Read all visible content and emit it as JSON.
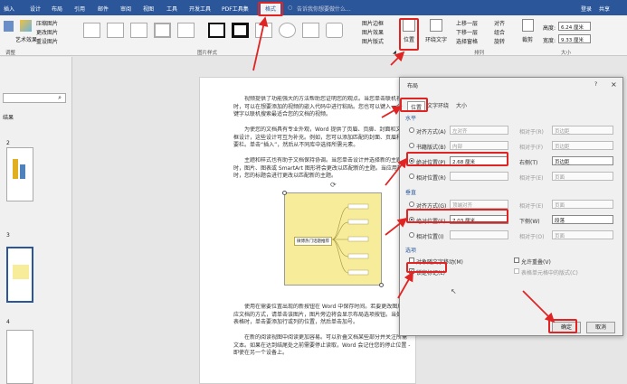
{
  "tabs": [
    "插入",
    "设计",
    "布局",
    "引用",
    "邮件",
    "审阅",
    "视图",
    "工具",
    "开发工具",
    "PDF工具集",
    "格式"
  ],
  "search_placeholder": "告诉我你想要做什么...",
  "user": {
    "login": "登录",
    "share": "共享"
  },
  "ribbon": {
    "left_btn": "艺术效果",
    "adjust_items": [
      "压缩图片",
      "更改图片",
      "重设图片"
    ],
    "adjust_label": "调整",
    "style_label": "图片样式",
    "style_items": [
      "图片边框",
      "图片效果",
      "图片版式"
    ],
    "arrange_big": [
      "位置",
      "环绕文字"
    ],
    "arrange_items": [
      "上移一层",
      "下移一层",
      "选择窗格"
    ],
    "align_items": [
      "对齐",
      "组合",
      "旋转"
    ],
    "arrange_label": "排列",
    "crop": "裁剪",
    "height_label": "高度:",
    "height_value": "6.24 厘米",
    "width_label": "宽度:",
    "width_value": "9.33 厘米",
    "size_label": "大小"
  },
  "nav": {
    "search_icon": "search-icon",
    "results": "结果",
    "pages": [
      "2",
      "3",
      "4"
    ]
  },
  "doc": {
    "para1": "视频提供了功能强大的方法帮助您证明您的观点。当您单击联机视频时，可以在想要添加的视频的嵌入代码中进行粘贴。您也可以键入一个关键字以联机搜索最适合您的文档的视频。",
    "para2": "为使您的文档具有专业外观，Word 提供了页眉、页脚、封面和文本框设计，这些设计可互为补充。例如，您可以添加匹配的封面、页眉和提要栏。单击“插入”，然后从不同库中选择所需元素。",
    "para3": "主题和样式也有助于文档保持协调。当您单击设计并选择新的主题时，图片、图表或 SmartArt 图形将会更改以匹配新的主题。当应用样式时，您的标题会进行更改以匹配新的主题。",
    "mind_center": "微博热门话题推荐",
    "para4": "使用在需要位置出现的新按钮在 Word 中保存时间。若要更改图片适应文档的方式，请单击该图片，图片旁边将会显示布局选项按钮。当处理表格时，单击要添加行或列的位置，然后单击加号。",
    "para5": "在新的阅读视图中阅读更加容易。可以折叠文档某些部分并关注所需文本。如果在达到结尾处之前需要停止读取，Word 会记住您的停止位置 - 即使在另一个设备上。"
  },
  "dialog": {
    "title": "布局",
    "help": "?",
    "close": "×",
    "tabs": [
      "位置",
      "文字环绕",
      "大小"
    ],
    "horizontal": "水平",
    "h_rows": [
      {
        "label": "对齐方式(A)",
        "value": "左对齐",
        "rel_label": "相对于(R)",
        "rel": "页边距",
        "on": false,
        "en": false
      },
      {
        "label": "书籍版式(B)",
        "value": "内部",
        "rel_label": "相对于(F)",
        "rel": "页边距",
        "on": false,
        "en": false
      },
      {
        "label": "绝对位置(P)",
        "value": "2.68 厘米",
        "rel_label": "右侧(T)",
        "rel": "页边距",
        "on": true,
        "en": true
      },
      {
        "label": "相对位置(R)",
        "value": "",
        "rel_label": "相对于(E)",
        "rel": "页面",
        "on": false,
        "en": false
      }
    ],
    "vertical": "垂直",
    "v_rows": [
      {
        "label": "对齐方式(G)",
        "value": "顶端对齐",
        "rel_label": "相对于(E)",
        "rel": "页面",
        "on": false,
        "en": false
      },
      {
        "label": "绝对位置(S)",
        "value": "7.03 厘米",
        "rel_label": "下侧(W)",
        "rel": "段落",
        "on": true,
        "en": true
      },
      {
        "label": "相对位置(I)",
        "value": "",
        "rel_label": "相对于(O)",
        "rel": "页面",
        "on": false,
        "en": false
      }
    ],
    "options": "选项",
    "opt_move": "对象随文字移动(M)",
    "opt_lock": "锁定标记(L)",
    "opt_overlap": "允许重叠(V)",
    "opt_table": "表格单元格中的版式(C)",
    "ok": "确定",
    "cancel": "取消",
    "accent": "#e02424"
  }
}
